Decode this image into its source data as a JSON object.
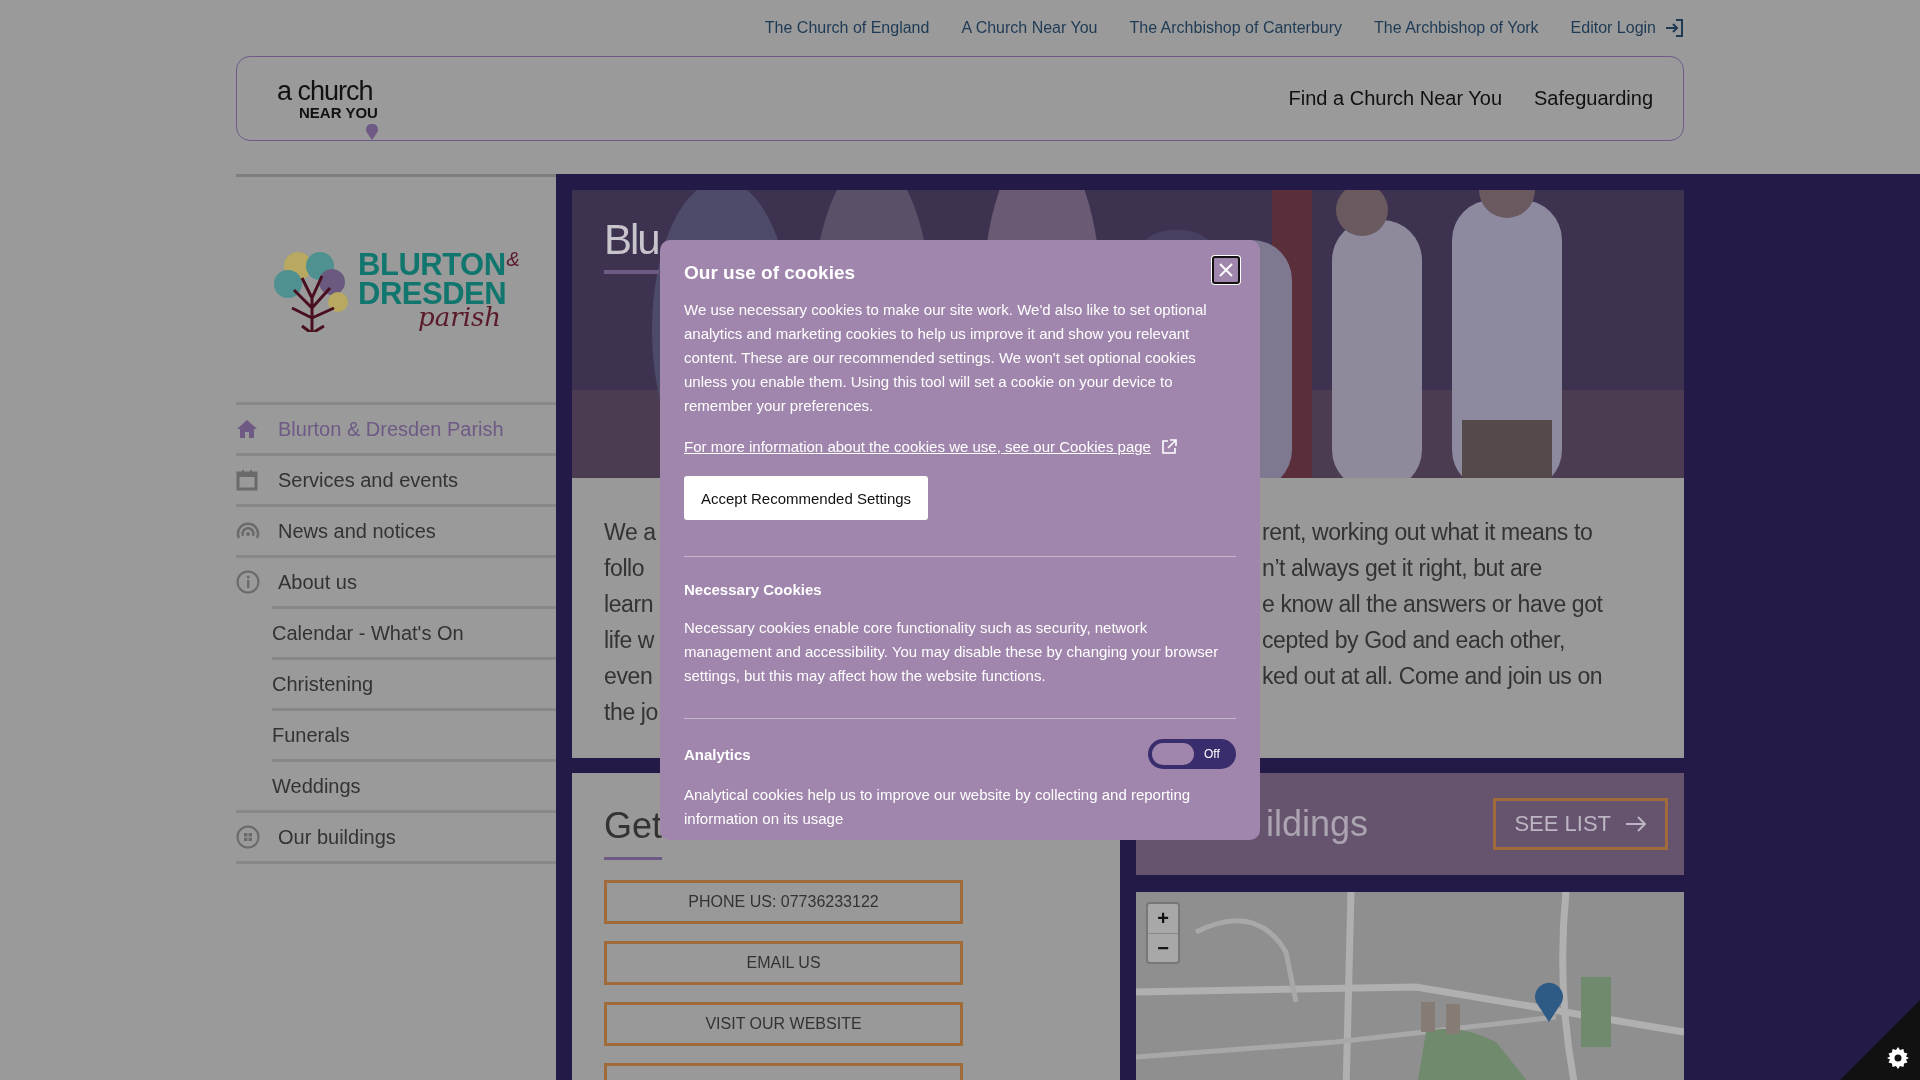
{
  "top_links": [
    {
      "label": "The Church of England",
      "kind": "link"
    },
    {
      "label": "A Church Near You",
      "kind": "link"
    },
    {
      "label": "The Archbishop of Canterbury",
      "kind": "link"
    },
    {
      "label": "The Archbishop of York",
      "kind": "link"
    },
    {
      "label": "Editor Login",
      "kind": "login"
    }
  ],
  "header": {
    "logo": {
      "line1": "a church",
      "line2": "NEAR YOU"
    },
    "nav": [
      "Find a Church Near You",
      "Safeguarding"
    ]
  },
  "sidebar": {
    "logo": {
      "name_1": "BLURTON",
      "ampersand": "&",
      "name_2": "DRESDEN",
      "script": "parish"
    },
    "items": [
      {
        "label": "Blurton & Dresden Parish",
        "selected": true
      },
      {
        "label": "Services and events",
        "selected": false
      },
      {
        "label": "News and notices",
        "selected": false
      },
      {
        "label": "About us",
        "selected": false,
        "children": [
          {
            "label": "Calendar - What's On",
            "selected": false
          },
          {
            "label": "Christening",
            "selected": false
          },
          {
            "label": "Funerals",
            "selected": false
          },
          {
            "label": "Weddings",
            "selected": false
          }
        ]
      },
      {
        "label": "Our buildings",
        "selected": false
      }
    ]
  },
  "hero": {
    "kind": "picture",
    "title": "Blu"
  },
  "intro": {
    "lines": [
      {
        "left": "We a",
        "right": "rent, working out what it means to"
      },
      {
        "left": "follo",
        "right": "n’t always get it right, but are"
      },
      {
        "left": "learn",
        "right": "e know all the answers or have got"
      },
      {
        "left": "life w",
        "right": "cepted by God and each other,"
      },
      {
        "left": "even",
        "right": "ked out at all. Come and join us on"
      },
      {
        "left": "the jo"
      }
    ]
  },
  "contact": {
    "heading": "Get",
    "buttons": [
      "PHONE US: 07736233122",
      "EMAIL US",
      "VISIT OUR WEBSITE"
    ]
  },
  "buildings": {
    "heading": "ildings",
    "button": "SEE LIST"
  },
  "map": {
    "kind": "picture",
    "zoom_in": "+",
    "zoom_out": "−"
  },
  "cookie_modal": {
    "title": "Our use of cookies",
    "intro": "We use necessary cookies to make our site work. We'd also like to set optional analytics and marketing cookies to help us improve it and show you relevant content. These are our recommended settings. We won't set optional cookies unless you enable them. Using this tool will set a cookie on your device to remember your preferences.",
    "link": "For more information about the cookies we use, see our Cookies page",
    "accept": "Accept Recommended Settings",
    "sections": [
      {
        "kind": "info",
        "title": "Necessary Cookies",
        "text": "Necessary cookies enable core functionality such as security, network management and accessibility. You may disable these by changing your browser settings, but this may affect how the website functions."
      },
      {
        "kind": "toggle",
        "title": "Analytics",
        "on": false,
        "state_label": "Off",
        "text": "Analytical cookies help us to improve our website by collecting and reporting information on its usage"
      }
    ]
  }
}
